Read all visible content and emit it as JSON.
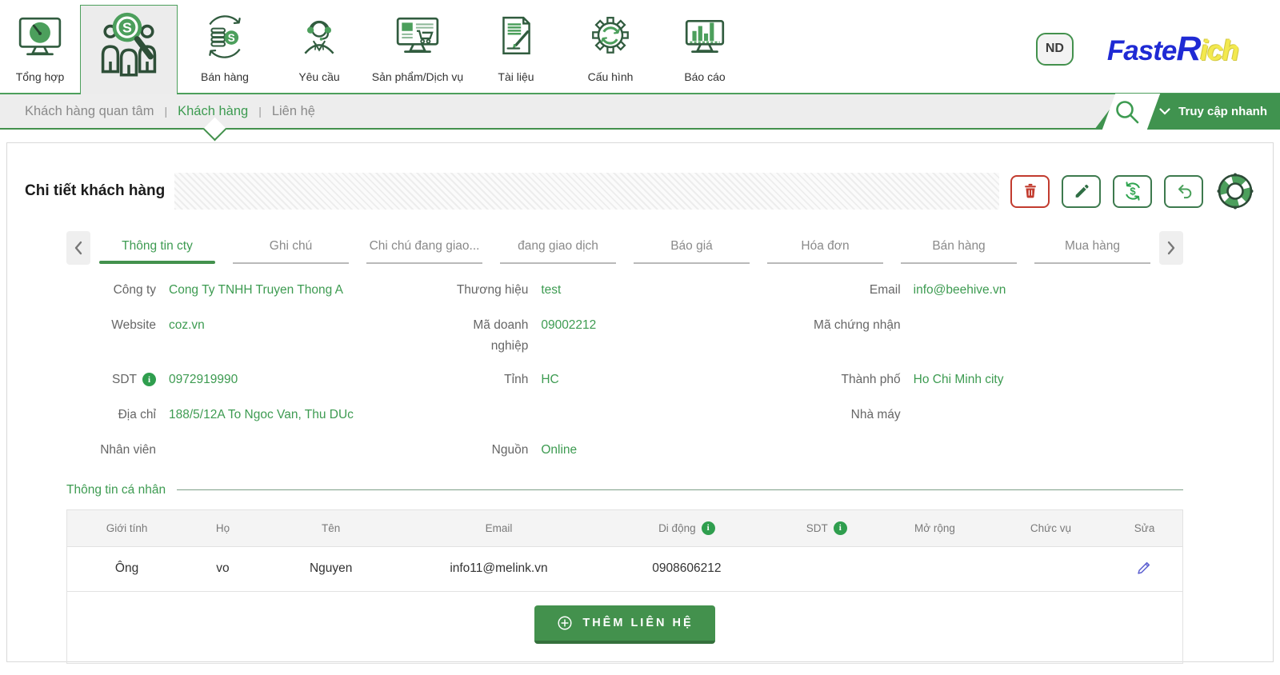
{
  "header": {
    "modules": [
      {
        "label": "Tổng hợp",
        "icon": "dashboard-monitor"
      },
      {
        "label": "",
        "icon": "customers-search",
        "active": true
      },
      {
        "label": "Bán hàng",
        "icon": "coins-sync"
      },
      {
        "label": "Yêu cầu",
        "icon": "support-headset"
      },
      {
        "label": "Sản phẩm/Dịch vụ",
        "icon": "monitor-cart"
      },
      {
        "label": "Tài liệu",
        "icon": "document-pen"
      },
      {
        "label": "Cấu hình",
        "icon": "gear-sync"
      },
      {
        "label": "Báo cáo",
        "icon": "chart-monitor"
      }
    ],
    "user_badge": "ND",
    "logo": {
      "part1": "Faste",
      "part2": "R",
      "part3": "ich"
    }
  },
  "subnav": {
    "items": [
      {
        "label": "Khách hàng quan tâm",
        "active": false
      },
      {
        "label": "Khách hàng",
        "active": true
      },
      {
        "label": "Liên hệ",
        "active": false
      }
    ],
    "quick_access_label": "Truy cập nhanh"
  },
  "page": {
    "title": "Chi tiết khách hàng"
  },
  "tabs": [
    "Thông tin cty",
    "Ghi chú",
    "Chi chú đang giao...",
    "đang giao dịch",
    "Báo giá",
    "Hóa đơn",
    "Bán hàng",
    "Mua hàng"
  ],
  "fields": {
    "company": {
      "label": "Công ty",
      "value": "Cong Ty TNHH Truyen Thong A"
    },
    "brand": {
      "label": "Thương hiệu",
      "value": "test"
    },
    "email": {
      "label": "Email",
      "value": "info@beehive.vn"
    },
    "website": {
      "label": "Website",
      "value": "coz.vn"
    },
    "business_code": {
      "label": "Mã doanh nghiệp",
      "value": "09002212"
    },
    "cert_code": {
      "label": "Mã chứng nhận",
      "value": ""
    },
    "phone": {
      "label": "SDT",
      "value": "0972919990"
    },
    "province": {
      "label": "Tỉnh",
      "value": "HC"
    },
    "city": {
      "label": "Thành phố",
      "value": "Ho Chi Minh city"
    },
    "address": {
      "label": "Địa chỉ",
      "value": "188/5/12A To Ngoc Van, Thu DUc"
    },
    "factory": {
      "label": "Nhà máy",
      "value": ""
    },
    "staff": {
      "label": "Nhân viên",
      "value": ""
    },
    "source": {
      "label": "Nguồn",
      "value": "Online"
    }
  },
  "personal_section": {
    "title": "Thông tin cá nhân"
  },
  "contacts": {
    "headers": [
      "Giới tính",
      "Họ",
      "Tên",
      "Email",
      "Di động",
      "SDT",
      "Mở rộng",
      "Chức vụ",
      "Sửa"
    ],
    "rows": [
      {
        "gender": "Ông",
        "last_name": "vo",
        "first_name": "Nguyen",
        "email": "info11@melink.vn",
        "mobile": "0908606212",
        "phone": "",
        "extension": "",
        "position": ""
      }
    ],
    "add_button_label": "THÊM LIÊN HỆ"
  },
  "colors": {
    "accent_green": "#43914d",
    "value_green": "#3d9b51",
    "link_blue": "#4a5fc9",
    "phone_blue": "#3f7ec7",
    "danger_red": "#c23b2e",
    "logo_blue": "#1f2ad4",
    "logo_yellow": "#f3e94e"
  }
}
